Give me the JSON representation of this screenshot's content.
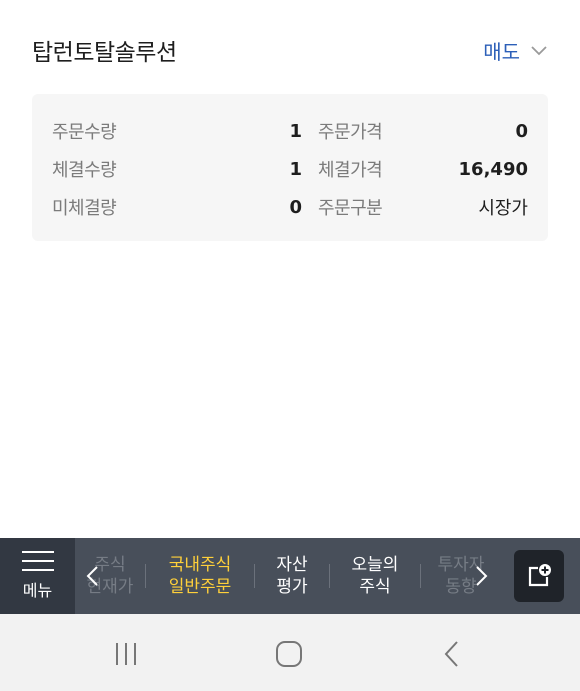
{
  "header": {
    "stock_name": "탑런토탈솔루션",
    "trade_type": "매도"
  },
  "order_info": {
    "rows": [
      {
        "label_left": "주문수량",
        "value_left": "1",
        "label_right": "주문가격",
        "value_right": "0"
      },
      {
        "label_left": "체결수량",
        "value_left": "1",
        "label_right": "체결가격",
        "value_right": "16,490"
      },
      {
        "label_left": "미체결량",
        "value_left": "0",
        "label_right": "주문구분",
        "value_right": "시장가"
      }
    ]
  },
  "bottom_bar": {
    "menu_label": "메뉴",
    "tabs": [
      {
        "line1": "주식",
        "line2": "현재가"
      },
      {
        "line1": "국내주식",
        "line2": "일반주문"
      },
      {
        "line1": "자산",
        "line2": "평가"
      },
      {
        "line1": "오늘의",
        "line2": "주식"
      },
      {
        "line1": "투자자",
        "line2": "동향"
      }
    ]
  },
  "colors": {
    "accent_blue": "#2c5fb8",
    "active_tab": "#ffd03a",
    "bar_bg": "#484f5a"
  },
  "icons": {
    "trade_dropdown": "chevron-down-icon",
    "menu": "hamburger-icon",
    "tab_prev": "chevron-left-icon",
    "tab_next": "chevron-right-icon",
    "new_window": "new-window-icon",
    "recent_apps": "recent-apps-icon",
    "home": "home-icon",
    "back": "back-icon"
  }
}
